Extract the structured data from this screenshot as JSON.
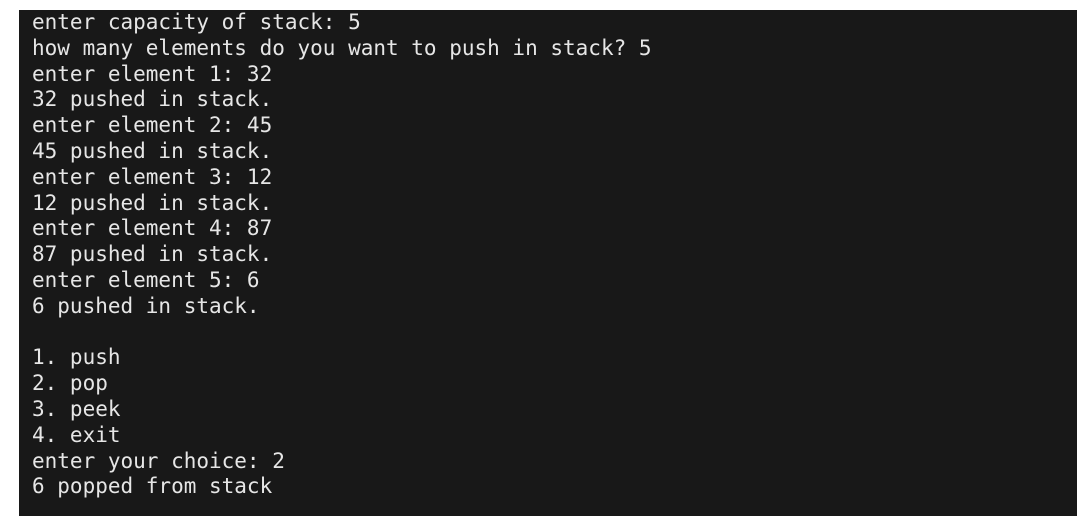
{
  "terminal": {
    "lines": [
      "enter capacity of stack: 5",
      "how many elements do you want to push in stack? 5",
      "enter element 1: 32",
      "32 pushed in stack.",
      "enter element 2: 45",
      "45 pushed in stack.",
      "enter element 3: 12",
      "12 pushed in stack.",
      "enter element 4: 87",
      "87 pushed in stack.",
      "enter element 5: 6",
      "6 pushed in stack.",
      "",
      "1. push",
      "2. pop",
      "3. peek",
      "4. exit",
      "enter your choice: 2",
      "6 popped from stack"
    ],
    "colors": {
      "background": "#181818",
      "text": "#e6e6e6"
    }
  }
}
